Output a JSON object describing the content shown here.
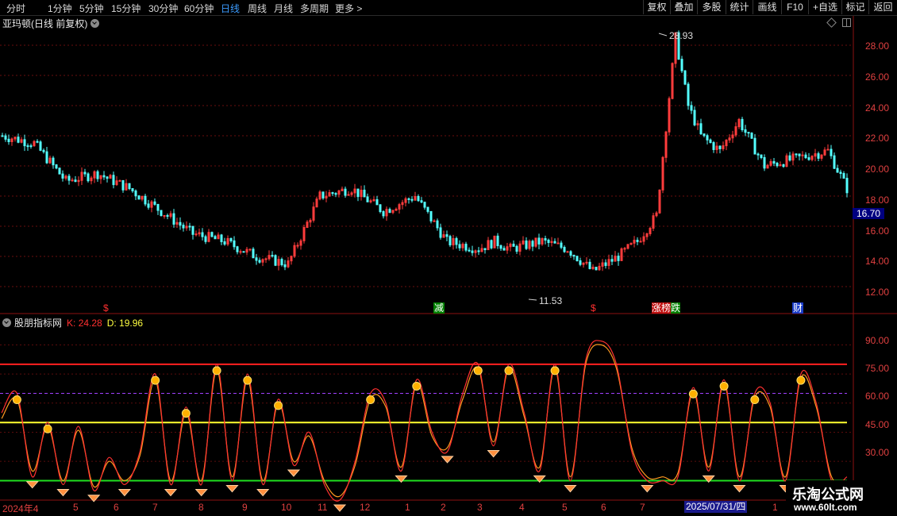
{
  "toolbar": {
    "periods": [
      "分时",
      "1分钟",
      "5分钟",
      "15分钟",
      "30分钟",
      "60分钟",
      "日线",
      "周线",
      "月线",
      "多周期",
      "更多 >"
    ],
    "active_period": "日线",
    "right_buttons": [
      "复权",
      "叠加",
      "多股",
      "统计",
      "画线",
      "F10",
      "+自选",
      "标记",
      "返回"
    ]
  },
  "stock": {
    "title": "亚玛顿(日线 前复权)"
  },
  "price_axis": [
    "28.00",
    "26.00",
    "24.00",
    "22.00",
    "20.00",
    "18.00",
    "16.00",
    "14.00",
    "12.00"
  ],
  "current_price": "16.70",
  "annotations": {
    "high": "28.93",
    "low": "11.53"
  },
  "events": [
    {
      "text": "$",
      "style": "red"
    },
    {
      "text": "减",
      "style": "green"
    },
    {
      "text": "$",
      "style": "red"
    },
    {
      "text": "财",
      "style": "blue"
    }
  ],
  "event_mix": {
    "a": "涨榜",
    "b": "跌"
  },
  "indicator": {
    "name": "股朋指标网",
    "k_label": "K: 24.28",
    "d_label": "D: 19.96"
  },
  "indicator_axis": [
    "90.00",
    "75.00",
    "60.00",
    "45.00",
    "30.00"
  ],
  "levels": {
    "upper": 80,
    "mid": 50,
    "lower": 20,
    "dashed": 65,
    "upper_color": "#ff2020",
    "mid_color": "#ffff30",
    "lower_color": "#20e020",
    "dashed_color": "#a040ff"
  },
  "x_axis": {
    "labels": [
      "2024年4",
      "5",
      "6",
      "7",
      "8",
      "9",
      "10",
      "11",
      "12",
      "1",
      "2",
      "3",
      "4",
      "5",
      "6",
      "7",
      "1"
    ],
    "cursor_date": "2025/07/31/四"
  },
  "watermark": {
    "line1": "乐淘公式网",
    "line2": "www.60lt.com"
  },
  "chart_data": {
    "type": "line",
    "price_series": {
      "name": "亚玛顿",
      "x_index": [
        0,
        10,
        20,
        30,
        40,
        50,
        60,
        70,
        80,
        90,
        100,
        110,
        120,
        130,
        140,
        150,
        155,
        160,
        170,
        178,
        186,
        194,
        200,
        206,
        212,
        216,
        220,
        226,
        232,
        240,
        250,
        260,
        266
      ],
      "close": [
        22.0,
        21.5,
        19.0,
        19.5,
        18.5,
        17.0,
        15.5,
        15.0,
        14.0,
        13.5,
        18.0,
        18.5,
        17.0,
        18.0,
        15.0,
        14.5,
        15.0,
        14.5,
        15.0,
        14.5,
        13.0,
        14.0,
        15.0,
        16.7,
        28.5,
        24.0,
        22.0,
        21.0,
        23.0,
        20.0,
        20.5,
        21.0,
        18.5
      ],
      "high": 28.93,
      "low": 11.53
    },
    "indicator_series": [
      {
        "name": "K",
        "color": "#ff3030",
        "values": [
          55,
          65,
          22,
          50,
          18,
          48,
          15,
          32,
          18,
          35,
          75,
          18,
          58,
          18,
          80,
          20,
          75,
          18,
          62,
          28,
          45,
          18,
          10,
          30,
          65,
          60,
          25,
          72,
          45,
          35,
          65,
          80,
          38,
          80,
          55,
          25,
          80,
          20,
          82,
          92,
          80,
          35,
          20,
          20,
          22,
          68,
          25,
          72,
          20,
          65,
          60,
          20,
          75,
          60,
          20,
          22
        ]
      },
      {
        "name": "D",
        "color": "#ff9a20",
        "values": [
          52,
          62,
          25,
          48,
          20,
          46,
          17,
          30,
          20,
          33,
          72,
          20,
          55,
          20,
          77,
          22,
          72,
          20,
          60,
          30,
          43,
          20,
          12,
          28,
          62,
          58,
          27,
          70,
          43,
          37,
          62,
          78,
          40,
          78,
          53,
          27,
          78,
          22,
          80,
          90,
          78,
          37,
          22,
          22,
          24,
          66,
          27,
          70,
          22,
          63,
          58,
          22,
          73,
          58,
          22,
          20
        ]
      }
    ],
    "y_range_price": [
      11,
      29
    ],
    "y_range_indicator": [
      10,
      100
    ],
    "grid": true
  }
}
